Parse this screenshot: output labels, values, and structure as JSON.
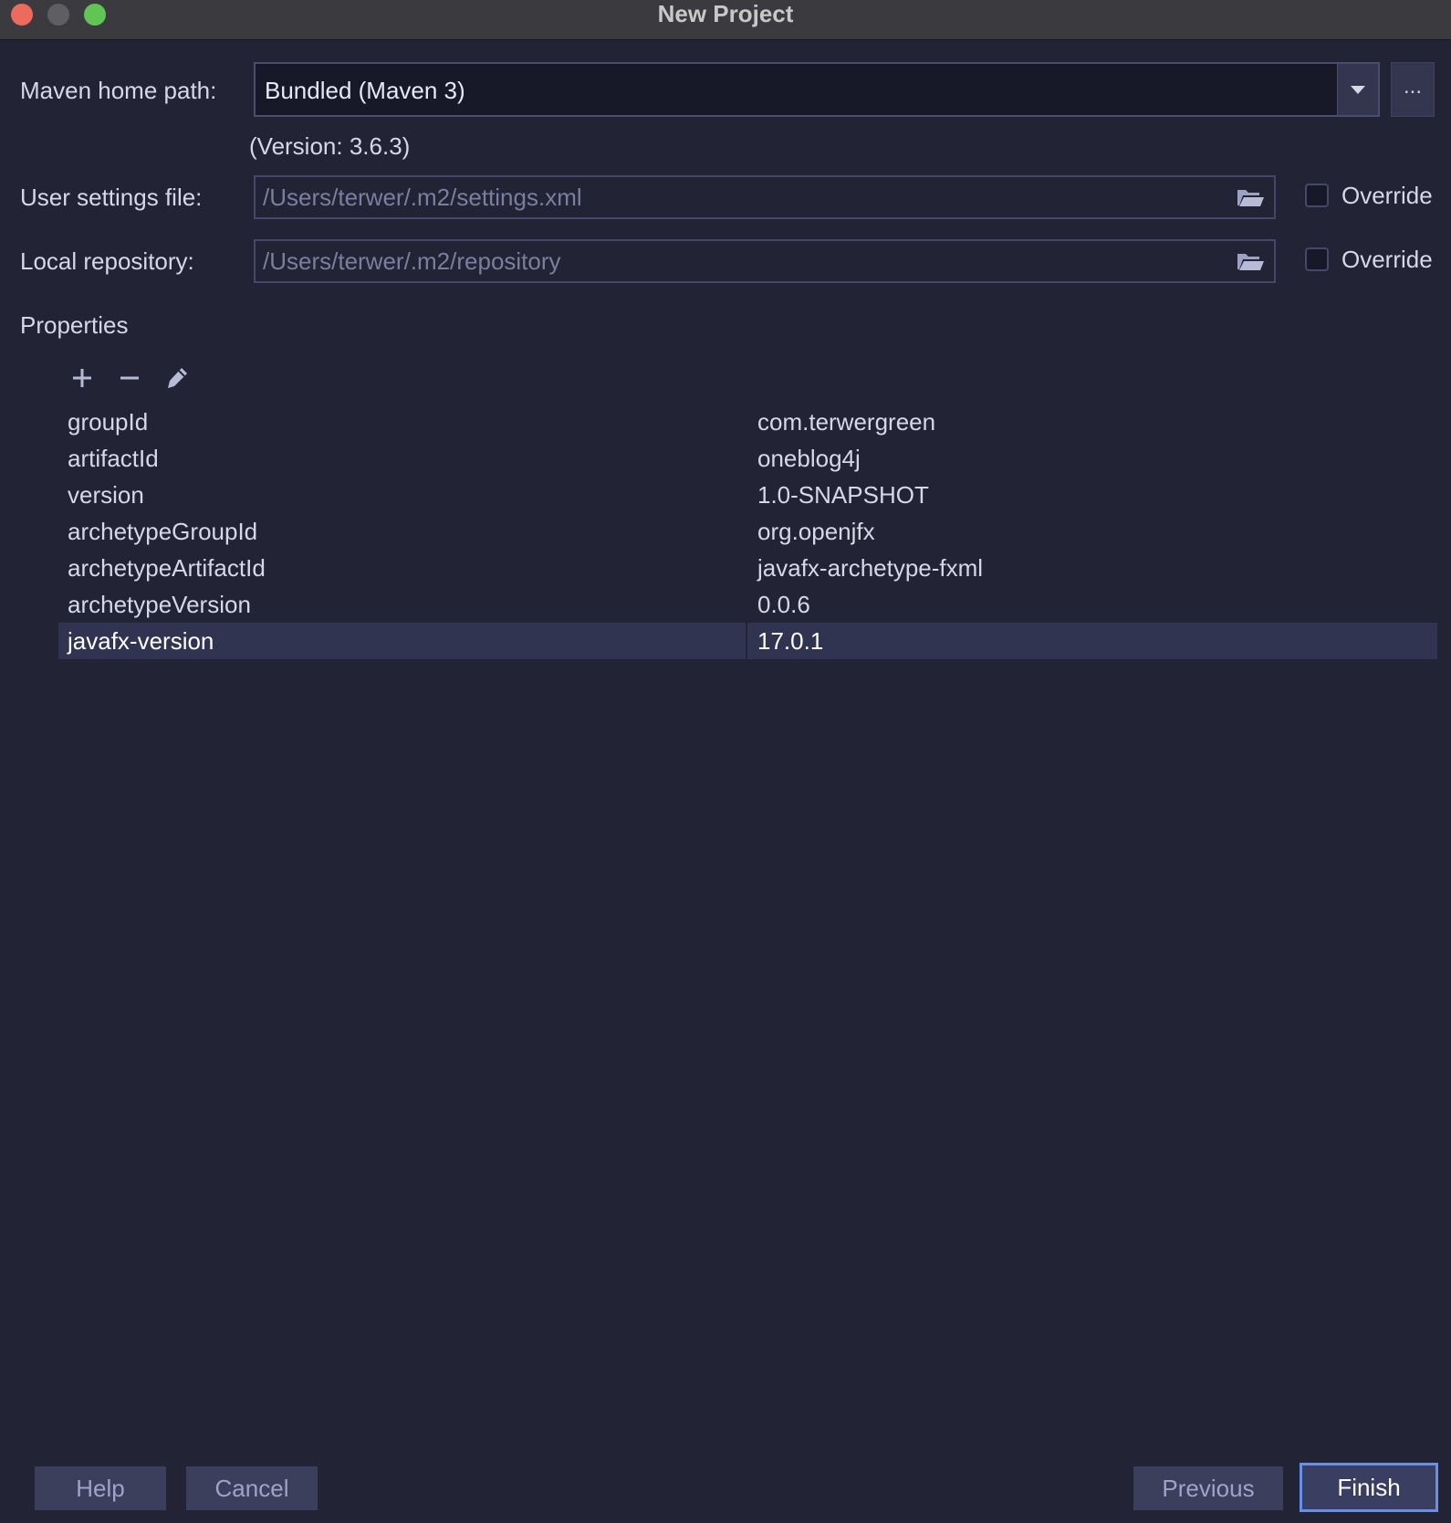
{
  "window": {
    "title": "New Project"
  },
  "maven": {
    "label": "Maven home path:",
    "value": "Bundled (Maven 3)",
    "browse_label": "...",
    "version": "(Version: 3.6.3)"
  },
  "user_settings": {
    "label": "User settings file:",
    "value": "/Users/terwer/.m2/settings.xml",
    "override_label": "Override",
    "override_checked": false
  },
  "local_repo": {
    "label": "Local repository:",
    "value": "/Users/terwer/.m2/repository",
    "override_label": "Override",
    "override_checked": false
  },
  "properties": {
    "title": "Properties",
    "toolbar": [
      "add-icon",
      "remove-icon",
      "edit-icon"
    ],
    "rows": [
      {
        "key": "groupId",
        "value": "com.terwergreen"
      },
      {
        "key": "artifactId",
        "value": "oneblog4j"
      },
      {
        "key": "version",
        "value": "1.0-SNAPSHOT"
      },
      {
        "key": "archetypeGroupId",
        "value": "org.openjfx"
      },
      {
        "key": "archetypeArtifactId",
        "value": "javafx-archetype-fxml"
      },
      {
        "key": "archetypeVersion",
        "value": "0.0.6"
      },
      {
        "key": "javafx-version",
        "value": "17.0.1"
      }
    ],
    "selected_row": "javafx-version"
  },
  "buttons": {
    "help": "Help",
    "cancel": "Cancel",
    "previous": "Previous",
    "finish": "Finish"
  },
  "colors": {
    "background": "#222436",
    "accent": "#6a8fe6",
    "selection": "#313451"
  }
}
